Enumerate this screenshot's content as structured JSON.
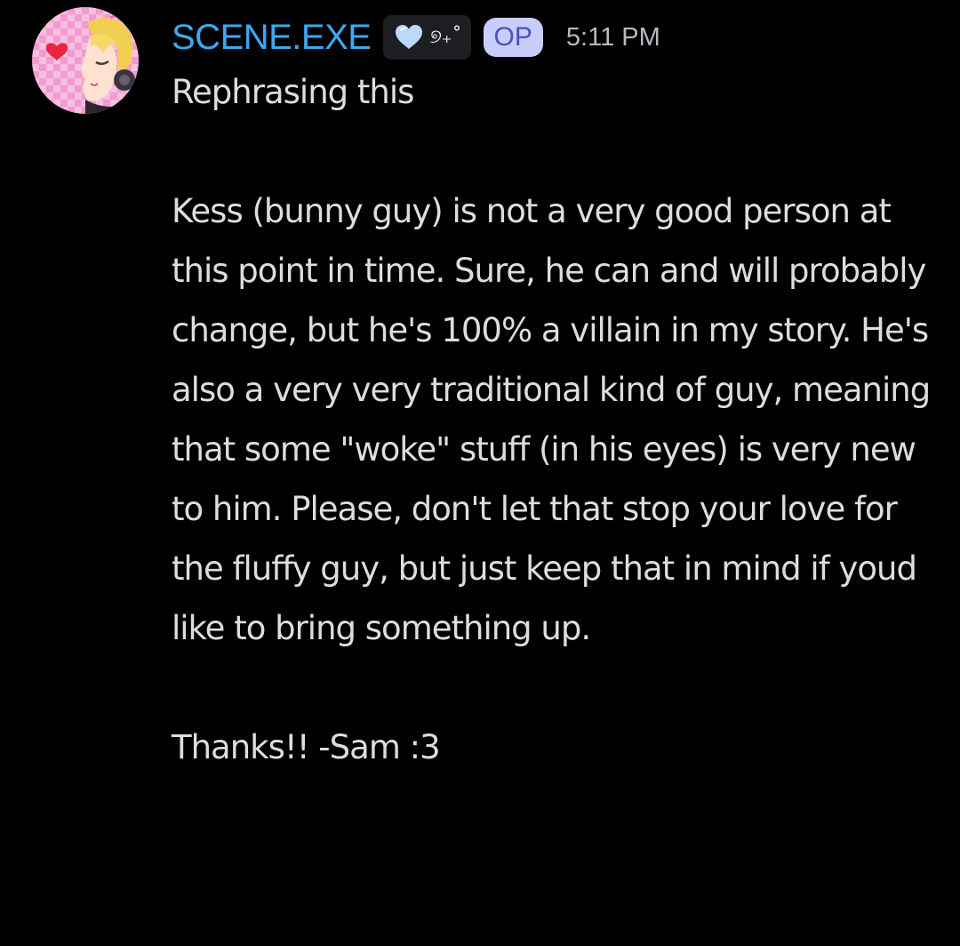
{
  "message": {
    "author": {
      "username": "SCENE.EXE",
      "role_badge_icon": "heart-icon",
      "role_badge_text": "୭₊˚",
      "op_badge": "OP",
      "username_color": "#3da8f2"
    },
    "timestamp": "5:11 PM",
    "body": "Rephrasing this\n\nKess (bunny guy) is not a very good person at this point in time. Sure, he can and will probably change, but he's 100% a villain in my story. He's also a very very traditional kind of guy, meaning that some \"woke\" stuff (in his eyes) is very new to him. Please, don't let that stop your love for the fluffy guy, but just keep that in mind if youd like to bring something up.\n\nThanks!! -Sam :3"
  }
}
